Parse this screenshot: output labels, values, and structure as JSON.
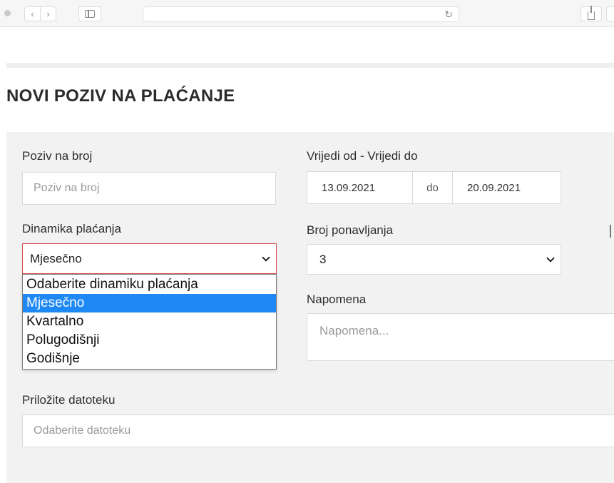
{
  "page": {
    "title": "NOVI POZIV NA PLAĆANJE"
  },
  "form": {
    "reference": {
      "label": "Poziv na broj",
      "placeholder": "Poziv na broj"
    },
    "validity": {
      "label": "Vrijedi od - Vrijedi do",
      "from": "13.09.2021",
      "separator": "do",
      "to": "20.09.2021"
    },
    "dynamics": {
      "label": "Dinamika plaćanja",
      "selected": "Mjesečno",
      "options": [
        "Odaberite dinamiku plaćanja",
        "Mjesečno",
        "Kvartalno",
        "Polugodišnji",
        "Godišnje"
      ],
      "highlighted_index": 1
    },
    "repetitions": {
      "label": "Broj ponavljanja",
      "selected": "3"
    },
    "note": {
      "label": "Napomena",
      "placeholder": "Napomena..."
    },
    "attachment": {
      "label": "Priložite datoteku",
      "placeholder": "Odaberite datoteku"
    }
  },
  "colors": {
    "dropdown_highlight": "#1e88f5",
    "open_select_border": "#d84a4a"
  }
}
